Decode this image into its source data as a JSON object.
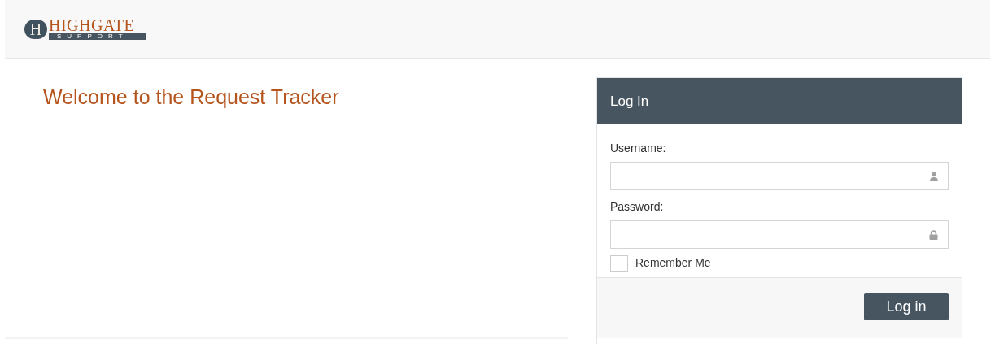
{
  "logo": {
    "mark": "H",
    "name": "HIGHGATE",
    "tagline": "SUPPORT"
  },
  "welcome": {
    "title": "Welcome to the Request Tracker"
  },
  "login": {
    "title": "Log In",
    "fields": [
      {
        "label": "Username:",
        "kind": "user"
      },
      {
        "label": "Password:",
        "kind": "password"
      }
    ],
    "remember": {
      "label": "Remember Me",
      "checked": false
    },
    "button": "Log in"
  }
}
